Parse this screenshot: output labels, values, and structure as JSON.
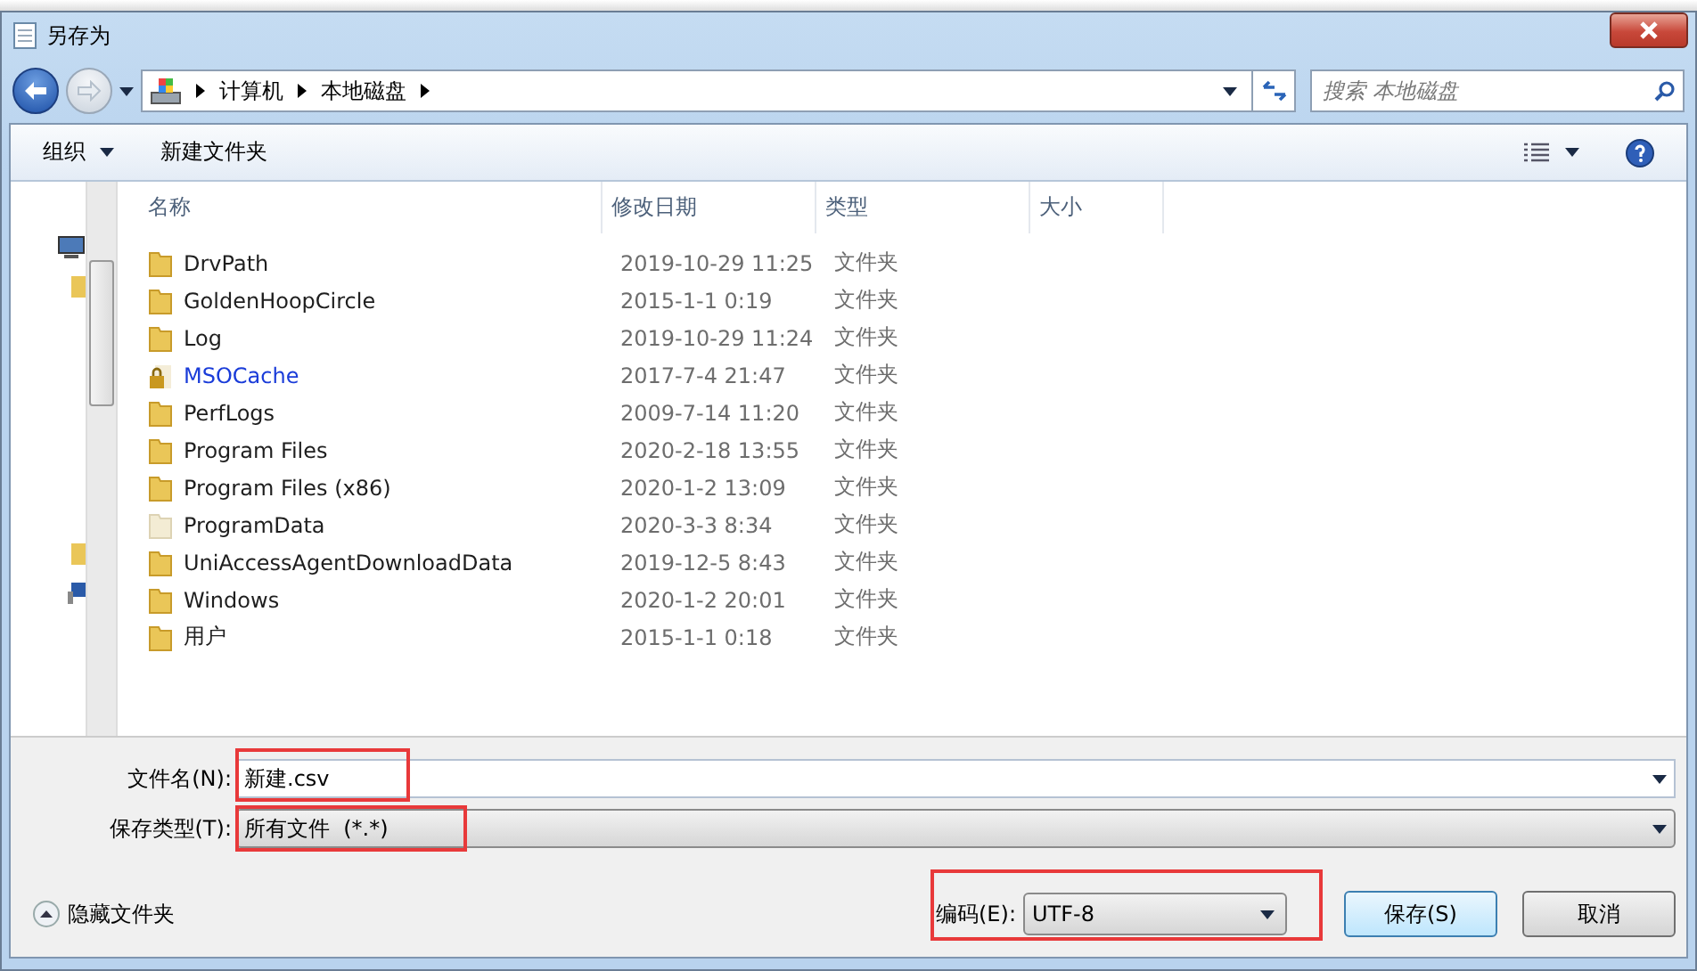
{
  "window": {
    "title": "另存为"
  },
  "breadcrumb": [
    "计算机",
    "本地磁盘"
  ],
  "search": {
    "placeholder": "搜索 本地磁盘"
  },
  "toolbar": {
    "organize": "组织",
    "new_folder": "新建文件夹"
  },
  "table": {
    "columns": [
      "名称",
      "修改日期",
      "类型",
      "大小"
    ],
    "rows": [
      {
        "name": "DrvPath",
        "modified": "2019-10-29 11:25",
        "type": "文件夹",
        "kind": "normal"
      },
      {
        "name": "GoldenHoopCircle",
        "modified": "2015-1-1 0:19",
        "type": "文件夹",
        "kind": "normal"
      },
      {
        "name": "Log",
        "modified": "2019-10-29 11:24",
        "type": "文件夹",
        "kind": "normal"
      },
      {
        "name": "MSOCache",
        "modified": "2017-7-4 21:47",
        "type": "文件夹",
        "kind": "locked"
      },
      {
        "name": "PerfLogs",
        "modified": "2009-7-14 11:20",
        "type": "文件夹",
        "kind": "normal"
      },
      {
        "name": "Program Files",
        "modified": "2020-2-18 13:55",
        "type": "文件夹",
        "kind": "normal"
      },
      {
        "name": "Program Files (x86)",
        "modified": "2020-1-2 13:09",
        "type": "文件夹",
        "kind": "normal"
      },
      {
        "name": "ProgramData",
        "modified": "2020-3-3 8:34",
        "type": "文件夹",
        "kind": "hidden"
      },
      {
        "name": "UniAccessAgentDownloadData",
        "modified": "2019-12-5 8:43",
        "type": "文件夹",
        "kind": "normal"
      },
      {
        "name": "Windows",
        "modified": "2020-1-2 20:01",
        "type": "文件夹",
        "kind": "normal"
      },
      {
        "name": "用户",
        "modified": "2015-1-1 0:18",
        "type": "文件夹",
        "kind": "normal"
      }
    ]
  },
  "filename": {
    "label": "文件名(N):",
    "value": "新建.csv"
  },
  "filetype": {
    "label": "保存类型(T):",
    "value": "所有文件  (*.*)"
  },
  "hide_folders": "隐藏文件夹",
  "encoding": {
    "label": "编码(E):",
    "value": "UTF-8"
  },
  "buttons": [
    "保存(S)",
    "取消"
  ]
}
